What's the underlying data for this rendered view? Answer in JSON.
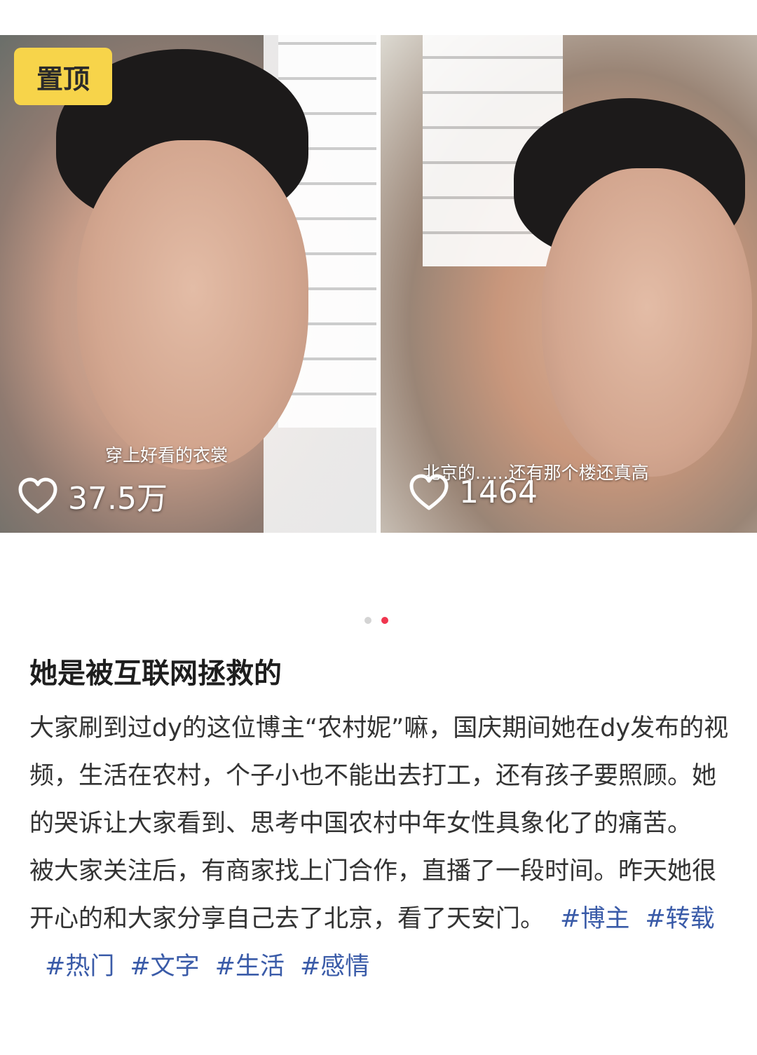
{
  "tiles": [
    {
      "badge": "置顶",
      "caption": "穿上好看的衣裳",
      "likes": "37.5万"
    },
    {
      "caption": "北京的......还有那个楼还真高",
      "likes": "1464"
    }
  ],
  "carousel": {
    "total_pages": 2,
    "active_page": 2
  },
  "post": {
    "title": "她是被互联网拯救的",
    "paragraph_1": "大家刷到过dy的这位博主“农村妮”嘛，国庆期间她在dy发布的视频，生活在农村，个子小也不能出去打工，还有孩子要照顾。她的哭诉让大家看到、思考中国农村中年女性具象化了的痛苦。",
    "paragraph_2": "被大家关注后，有商家找上门合作，直播了一段时间。昨天她很开心的和大家分享自己去了北京，看了天安门。",
    "tags": [
      "#博主",
      "#转载",
      "#热门",
      "#文字",
      "#生活",
      "#感情"
    ]
  },
  "colors": {
    "badge": "#f7d44a",
    "dot_active": "#f0364f",
    "dot_inactive": "#d4d4d4",
    "tag": "#3a5ba8"
  },
  "icons": {
    "like": "heart-outline-icon"
  }
}
